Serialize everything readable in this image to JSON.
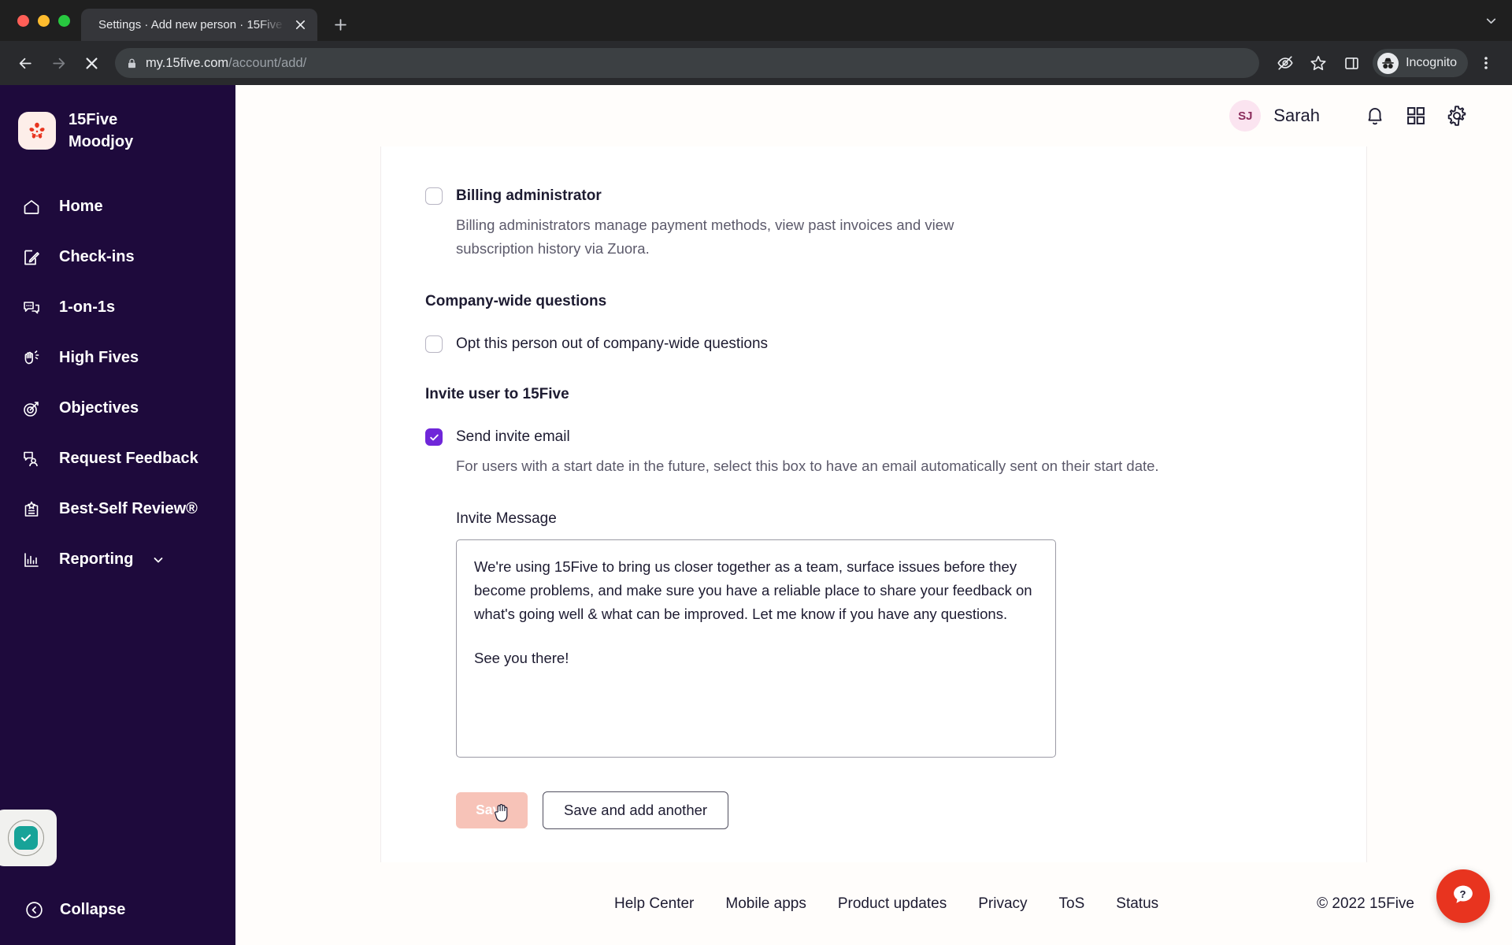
{
  "browser": {
    "tab_title": "Settings · Add new person · 15Five",
    "url_host": "my.15five.com",
    "url_path": "/account/add/",
    "profile_label": "Incognito",
    "icons": {
      "back": "back-arrow-icon",
      "forward": "forward-arrow-icon",
      "stop": "stop-loading-icon",
      "lock": "lock-icon",
      "eye_slash": "eye-slash-icon",
      "bookmark": "star-bookmark-icon",
      "side_panel": "side-panel-icon",
      "incognito": "incognito-avatar-icon",
      "menu": "three-dot-menu-icon",
      "new_tab": "plus-icon",
      "tab_close": "close-icon",
      "tab_list": "chevron-down-icon"
    }
  },
  "sidebar": {
    "brand_line1": "15Five",
    "brand_line2": "Moodjoy",
    "items": [
      {
        "label": "Home",
        "icon": "home-icon"
      },
      {
        "label": "Check-ins",
        "icon": "checkin-pencil-icon"
      },
      {
        "label": "1-on-1s",
        "icon": "chat-bubbles-icon"
      },
      {
        "label": "High Fives",
        "icon": "high-five-hand-icon"
      },
      {
        "label": "Objectives",
        "icon": "target-arrow-icon"
      },
      {
        "label": "Request Feedback",
        "icon": "feedback-person-icon"
      },
      {
        "label": "Best-Self Review®",
        "icon": "review-badge-icon"
      },
      {
        "label": "Reporting",
        "icon": "bar-chart-icon",
        "caret": true
      }
    ],
    "collapse_label": "Collapse",
    "widget_icon": "checkmark-badge-icon"
  },
  "topbar": {
    "avatar_initials": "SJ",
    "user_name": "Sarah",
    "icons": {
      "notifications": "bell-icon",
      "apps": "grid-apps-icon",
      "settings": "gear-icon"
    }
  },
  "form": {
    "billing_admin": {
      "label": "Billing administrator",
      "checked": false,
      "helper": "Billing administrators manage payment methods, view past invoices and view subscription history via Zuora."
    },
    "company_questions": {
      "section_title": "Company-wide questions",
      "opt_out_label": "Opt this person out of company-wide questions",
      "checked": false
    },
    "invite": {
      "section_title": "Invite user to 15Five",
      "send_invite_label": "Send invite email",
      "send_invite_checked": true,
      "send_invite_helper": "For users with a start date in the future, select this box to have an email automatically sent on their start date.",
      "message_label": "Invite Message",
      "message_paragraph_1": "We're using 15Five to bring us closer together as a team, surface issues before they become problems, and make sure you have a reliable place to share your feedback on what's going well & what can be improved. Let me know if you have any questions.",
      "message_paragraph_2": "See you there!"
    },
    "buttons": {
      "save": "Save",
      "save_disabled": true,
      "save_and_add_another": "Save and add another"
    }
  },
  "footer": {
    "links": [
      "Help Center",
      "Mobile apps",
      "Product updates",
      "Privacy",
      "ToS",
      "Status"
    ],
    "copyright": "© 2022 15Five"
  },
  "help_fab": {
    "icon": "question-chat-icon"
  },
  "colors": {
    "sidebar_bg": "#1e0a3c",
    "accent_purple": "#6f26d9",
    "save_disabled": "#f7c3b8",
    "help_red": "#e8341f",
    "brand_red": "#e8341f"
  }
}
